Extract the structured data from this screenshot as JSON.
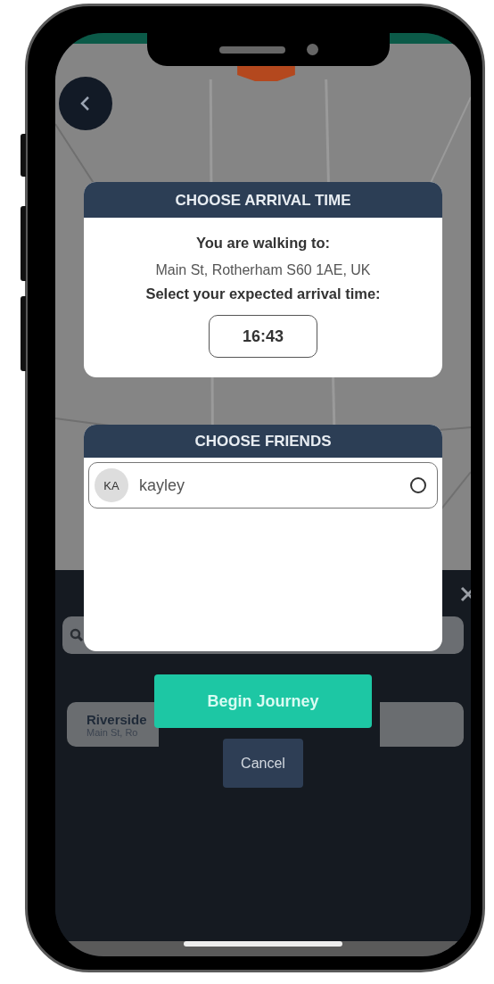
{
  "arrival_dialog": {
    "title": "CHOOSE ARRIVAL TIME",
    "intro": "You are walking to:",
    "destination": "Main St, Rotherham S60 1AE, UK",
    "prompt": "Select your expected arrival time:",
    "time": "16:43"
  },
  "friends_dialog": {
    "title": "CHOOSE FRIENDS",
    "friends": [
      {
        "initials": "KA",
        "name": "kayley",
        "selected": false
      }
    ]
  },
  "bottom_sheet": {
    "recent_locations": [
      {
        "name": "Riverside",
        "address": "Main St, Ro"
      }
    ]
  },
  "buttons": [
    {
      "kind": "primary",
      "label": "Begin Journey"
    },
    {
      "kind": "secondary",
      "label": "Cancel"
    }
  ]
}
